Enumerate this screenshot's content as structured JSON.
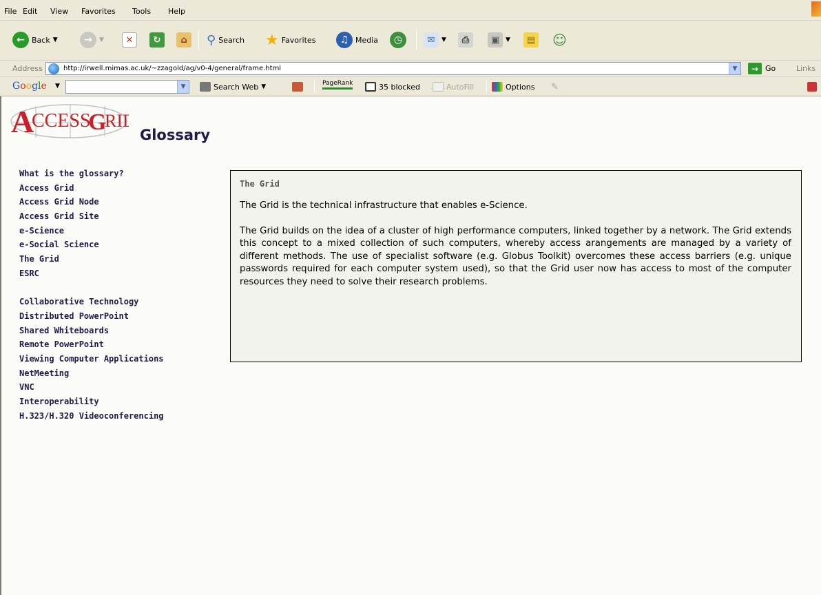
{
  "menubar": {
    "items": [
      "File",
      "Edit",
      "View",
      "Favorites",
      "Tools",
      "Help"
    ]
  },
  "toolbar": {
    "back_label": "Back",
    "search_label": "Search",
    "favorites_label": "Favorites",
    "media_label": "Media"
  },
  "addressbar": {
    "label": "Address",
    "url": "http://irwell.mimas.ac.uk/~zzagold/ag/v0-4/general/frame.html",
    "go_label": "Go",
    "links_label": "Links"
  },
  "googlebar": {
    "logo": "Google",
    "search_web_label": "Search Web",
    "pagerank_label": "PageRank",
    "blocked_label": "35 blocked",
    "autofill_label": "AutoFill",
    "options_label": "Options"
  },
  "page": {
    "logo_text": "ACCESS GRID",
    "title": "Glossary",
    "nav_group1": [
      "What is the glossary?",
      "Access Grid",
      "Access Grid Node",
      "Access Grid Site",
      "e-Science",
      "e-Social Science",
      "The Grid",
      "ESRC"
    ],
    "nav_group2": [
      "Collaborative Technology",
      "Distributed PowerPoint",
      "Shared Whiteboards",
      "Remote PowerPoint",
      "Viewing Computer Applications",
      "NetMeeting",
      "VNC",
      "Interoperability",
      "H.323/H.320 Videoconferencing"
    ],
    "content": {
      "title": "The Grid",
      "paragraphs": [
        "The Grid is the technical infrastructure that enables e-Science.",
        "The Grid builds on the idea of a cluster of high performance computers, linked together by a network. The Grid extends this concept to a mixed collection of such computers, whereby access arangements are managed by a variety of different methods. The use of specialist software (e.g. Globus Toolkit) overcomes these access barriers (e.g. unique passwords required for each computer system used), so that the Grid user now has access to most of the computer resources they need to solve their research problems."
      ]
    }
  }
}
